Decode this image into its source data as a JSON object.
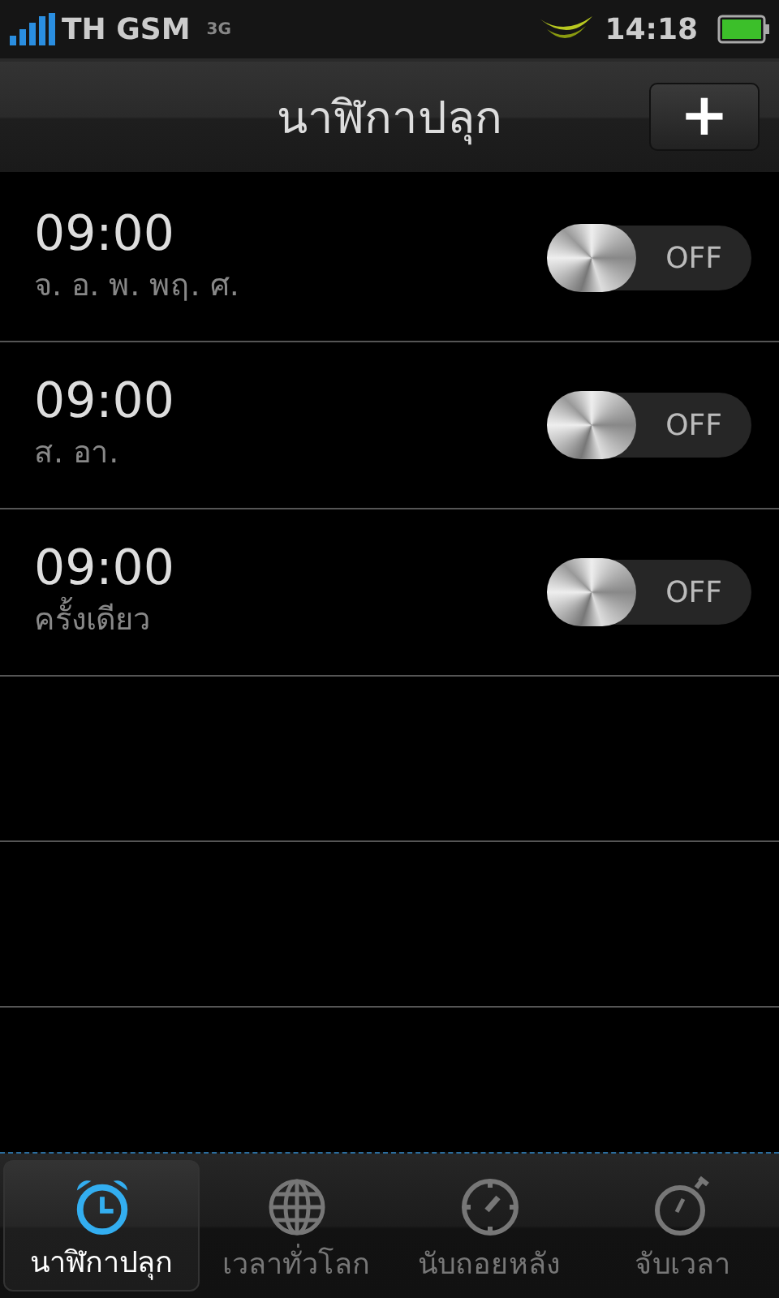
{
  "status_bar": {
    "carrier": "TH GSM",
    "network": "3G",
    "time": "14:18"
  },
  "title_bar": {
    "title": "นาฬิกาปลุก",
    "add_button": "+"
  },
  "alarms": [
    {
      "time": "09:00",
      "repeat": "จ. อ. พ. พฤ. ศ.",
      "on": false,
      "toggle_label": "OFF"
    },
    {
      "time": "09:00",
      "repeat": "ส. อา.",
      "on": false,
      "toggle_label": "OFF"
    },
    {
      "time": "09:00",
      "repeat": "ครั้งเดียว",
      "on": false,
      "toggle_label": "OFF"
    }
  ],
  "tabs": [
    {
      "label": "นาฬิกาปลุก",
      "kind": "alarm",
      "selected": true
    },
    {
      "label": "เวลาทั่วโลก",
      "kind": "globe",
      "selected": false
    },
    {
      "label": "นับถอยหลัง",
      "kind": "timer",
      "selected": false
    },
    {
      "label": "จับเวลา",
      "kind": "stopwatch",
      "selected": false
    }
  ]
}
